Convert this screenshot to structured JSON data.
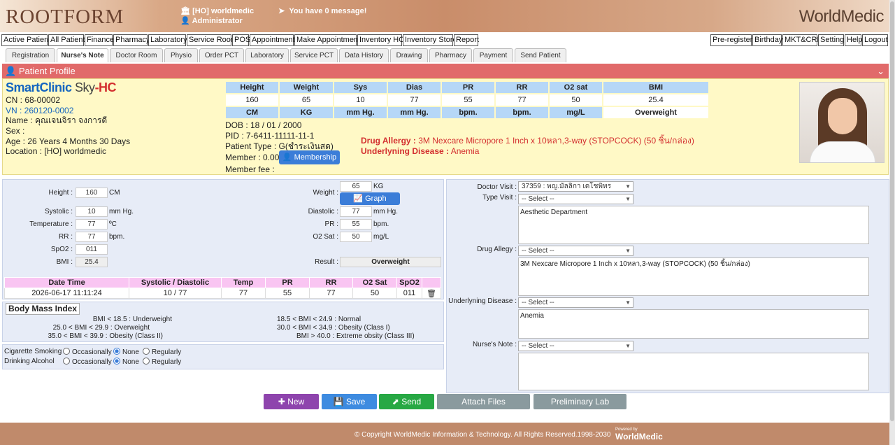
{
  "header": {
    "logo": "ROOTFORM",
    "branch": "[HO] worldmedic",
    "user": "Administrator",
    "message": "You have 0 message!",
    "brand": "WorldMedic"
  },
  "menu": [
    "Active Patient",
    "All Patient",
    "Finance",
    "Pharmacy",
    "Laboratory",
    "Service Room",
    "POS",
    "Appointment",
    "Make Appointment",
    "Inventory HO",
    "Inventory Store",
    "Report"
  ],
  "menu_right": [
    "Pre-register",
    "Birthday",
    "MKT&CRM",
    "Setting",
    "Help",
    "Logout"
  ],
  "tabs": [
    "Registration",
    "Nurse's Note",
    "Doctor Room",
    "Physio",
    "Order PCT",
    "Laboratory",
    "Service PCT",
    "Data History",
    "Drawing",
    "Pharmacy",
    "Payment",
    "Send Patient"
  ],
  "profile": {
    "title": "Patient Profile",
    "app_name": "SmartClinic",
    "app_sky": "Sky",
    "app_hc": "-HC",
    "cn": "CN : 68-00002",
    "vn": "VN : 260120-0002",
    "name": "Name : คุณเจนจิรา จงการดี",
    "sex": "Sex :",
    "age": "Age : 26 Years 4 Months 30 Days",
    "location": "Location : [HO] worldmedic",
    "dob": "DOB : 18 / 01 / 2000",
    "pid": "PID : 7-6411-11111-11-1",
    "patient_type": "Patient Type : G(ชำระเงินสด)",
    "member": "Member : 0.00",
    "membership_btn": "Membership",
    "member_fee": "Member fee :",
    "drug_allergy_label": "Drug Allergy :",
    "drug_allergy": " 3M Nexcare Micropore 1 Inch x 10หลา,3-way (STOPCOCK) (50 ชิ้น/กล่อง)",
    "disease_label": "Underlyning Disease :",
    "disease": " Anemia",
    "vitals_head": [
      "Height",
      "Weight",
      "Sys",
      "Dias",
      "PR",
      "RR",
      "O2 sat",
      "BMI"
    ],
    "vitals_values": [
      "160",
      "65",
      "10",
      "77",
      "55",
      "77",
      "50",
      "25.4"
    ],
    "vitals_units": [
      "CM",
      "KG",
      "mm Hg.",
      "mm Hg.",
      "bpm.",
      "bpm.",
      "mg/L",
      "Overweight"
    ]
  },
  "form": {
    "height_label": "Height :",
    "height": "160",
    "height_unit": "CM",
    "weight_label": "Weight :",
    "weight": "65",
    "weight_unit": "KG",
    "graph_btn": "Graph",
    "systolic_label": "Systolic :",
    "systolic": "10",
    "systolic_unit": "mm Hg.",
    "diastolic_label": "Diastolic :",
    "diastolic": "77",
    "diastolic_unit": "mm Hg.",
    "temp_label": "Temperature :",
    "temp": "77",
    "temp_unit": "ºC",
    "pr_label": "PR :",
    "pr": "55",
    "pr_unit": "bpm.",
    "rr_label": "RR :",
    "rr": "77",
    "rr_unit": "bpm.",
    "o2_label": "O2 Sat :",
    "o2": "50",
    "o2_unit": "mg/L",
    "spo2_label": "SpO2 :",
    "spo2": "011",
    "bmi_label": "BMI :",
    "bmi": "25.4",
    "result_label": "Result :",
    "result": "Overweight"
  },
  "history": {
    "headers": [
      "Date Time",
      "Systolic / Diastolic",
      "Temp",
      "PR",
      "RR",
      "O2 Sat",
      "SpO2"
    ],
    "rows": [
      [
        "2026-06-17 11:11:24",
        "10 / 77",
        "77",
        "55",
        "77",
        "50",
        "011"
      ]
    ]
  },
  "bmi_index": {
    "title": "Body Mass Index",
    "left": [
      "BMI < 18.5 : Underweight",
      "25.0 < BMI < 29.9 : Overweight",
      "35.0 < BMI < 39.9 : Obesity (Class II)"
    ],
    "right": [
      "18.5 < BMI < 24.9 : Normal",
      "30.0 < BMI < 34.9 : Obesity (Class I)",
      "BMI > 40.0 : Extreme obsity (Class III)"
    ]
  },
  "habits": {
    "smoking": "Cigarette Smoking",
    "alcohol": "Drinking Alcohol",
    "opt1": "Occasionally",
    "opt2": "None",
    "opt3": "Regularly",
    "smoking_selected": "None",
    "alcohol_selected": "None"
  },
  "right": {
    "doctor_label": "Doctor Visit :",
    "doctor": "37359 : พญ.มัลลิกา เดโชพิทร",
    "type_label": "Type Visit :",
    "type": "-- Select --",
    "type_text": "Aesthetic Department",
    "allergy_label": "Drug Allegy :",
    "allergy": "-- Select --",
    "allergy_text": "3M Nexcare Micropore 1 Inch x 10หลา,3-way (STOPCOCK) (50 ชิ้น/กล่อง)",
    "disease_label": "Underlyning Disease :",
    "disease": "-- Select --",
    "disease_text": "Anemia",
    "note_label": "Nurse's Note :",
    "note": "-- Select --",
    "note_text": ""
  },
  "buttons": {
    "new": "New",
    "save": "Save",
    "send": "Send",
    "attach": "Attach Files",
    "prelim": "Preliminary Lab"
  },
  "colors": {
    "new": "#8e44ad",
    "save": "#3d8be0",
    "send": "#27a844",
    "attach": "#8a9a9e",
    "prelim": "#8a9a9e",
    "profile_head": "#e16a6a"
  },
  "footer": {
    "copyright": "© Copyright WorldMedic Information & Technology. All Rights Reserved.1998-2030",
    "powered": "Powered by",
    "brand": "WorldMedic"
  }
}
